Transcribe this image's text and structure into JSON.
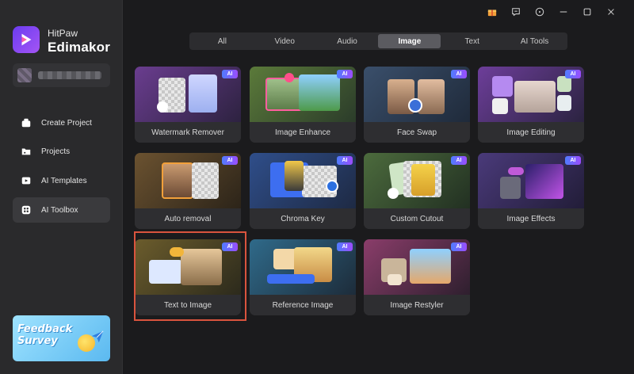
{
  "app": {
    "brand_small": "HitPaw",
    "brand_big": "Edimakor"
  },
  "sidebar": {
    "items": [
      {
        "label": "Create Project",
        "icon": "create-project-icon"
      },
      {
        "label": "Projects",
        "icon": "folder-icon"
      },
      {
        "label": "AI Templates",
        "icon": "templates-icon"
      },
      {
        "label": "AI Toolbox",
        "icon": "toolbox-icon",
        "active": true
      }
    ],
    "feedback_line1": "Feedback",
    "feedback_line2": "Survey"
  },
  "titlebar": {
    "icons": [
      "gift-icon",
      "feedback-icon",
      "info-icon",
      "minimize-icon",
      "maximize-icon",
      "close-icon"
    ]
  },
  "tabs": [
    {
      "label": "All"
    },
    {
      "label": "Video"
    },
    {
      "label": "Audio"
    },
    {
      "label": "Image",
      "active": true
    },
    {
      "label": "Text"
    },
    {
      "label": "AI Tools"
    }
  ],
  "badge": "AI",
  "tools": [
    {
      "label": "Watermark Remover"
    },
    {
      "label": "Image Enhance"
    },
    {
      "label": "Face Swap"
    },
    {
      "label": "Image Editing"
    },
    {
      "label": "Auto removal"
    },
    {
      "label": "Chroma Key"
    },
    {
      "label": "Custom Cutout"
    },
    {
      "label": "Image Effects"
    },
    {
      "label": "Text to Image",
      "highlighted": true
    },
    {
      "label": "Reference Image"
    },
    {
      "label": "Image Restyler"
    }
  ],
  "colors": {
    "accent": "#6b3cf0",
    "highlight_border": "#d9543e",
    "ai_badge_start": "#4f7cff",
    "ai_badge_end": "#9c4dff"
  }
}
